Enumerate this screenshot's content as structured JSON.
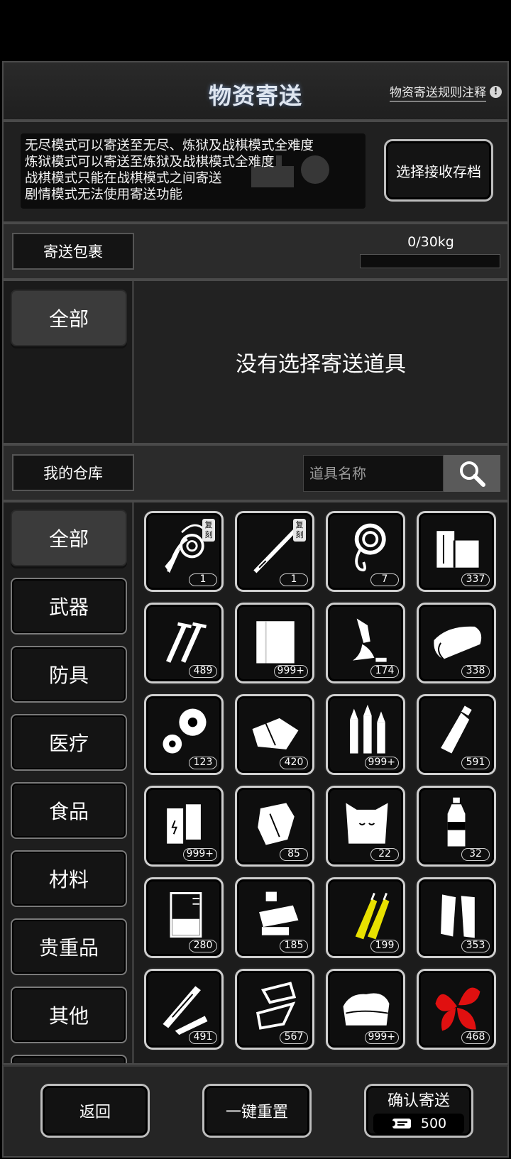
{
  "header": {
    "title": "物资寄送",
    "rules_link": "物资寄送规则注释"
  },
  "notice": {
    "lines": [
      "无尽模式可以寄送至无尽、炼狱及战棋模式全难度",
      "炼狱模式可以寄送至炼狱及战棋模式全难度",
      "战棋模式只能在战棋模式之间寄送",
      "剧情模式无法使用寄送功能"
    ],
    "select_save_button": "选择接收存档"
  },
  "package": {
    "label": "寄送包裹",
    "weight": "0/30kg",
    "weight_fraction": 0,
    "category": "全部",
    "empty_text": "没有选择寄送道具"
  },
  "warehouse": {
    "label": "我的仓库",
    "search_placeholder": "道具名称",
    "categories": [
      "全部",
      "武器",
      "防具",
      "医疗",
      "食品",
      "材料",
      "贵重品",
      "其他"
    ],
    "items": [
      {
        "icon": "whip-icon",
        "count": "1",
        "copy_tag": "复刻"
      },
      {
        "icon": "spear-icon",
        "count": "1",
        "copy_tag": "复刻"
      },
      {
        "icon": "rope-icon",
        "count": "7"
      },
      {
        "icon": "wood-icon",
        "count": "337"
      },
      {
        "icon": "screws-icon",
        "count": "489"
      },
      {
        "icon": "cloth-icon",
        "count": "999+"
      },
      {
        "icon": "glue-icon",
        "count": "174"
      },
      {
        "icon": "fabric-roll-icon",
        "count": "338"
      },
      {
        "icon": "gears-icon",
        "count": "123"
      },
      {
        "icon": "rags-icon",
        "count": "420"
      },
      {
        "icon": "bullets-icon",
        "count": "999+"
      },
      {
        "icon": "bottle-icon",
        "count": "591"
      },
      {
        "icon": "battery-icon",
        "count": "999+"
      },
      {
        "icon": "crumpled-paper-icon",
        "count": "85"
      },
      {
        "icon": "sack-icon",
        "count": "22"
      },
      {
        "icon": "water-bottle-icon",
        "count": "32"
      },
      {
        "icon": "beaker-icon",
        "count": "280"
      },
      {
        "icon": "drill-parts-icon",
        "count": "185"
      },
      {
        "icon": "electrodes-icon",
        "count": "199"
      },
      {
        "icon": "bandage-icon",
        "count": "353"
      },
      {
        "icon": "planks-icon",
        "count": "491"
      },
      {
        "icon": "metal-scrap-icon",
        "count": "567"
      },
      {
        "icon": "towels-icon",
        "count": "999+"
      },
      {
        "icon": "herb-leaves-icon",
        "count": "468"
      }
    ]
  },
  "footer": {
    "back": "返回",
    "reset": "一键重置",
    "confirm": "确认寄送",
    "cost": "500"
  },
  "colors": {
    "herb_red": "#e01010",
    "electrode_yellow": "#e8e000"
  }
}
